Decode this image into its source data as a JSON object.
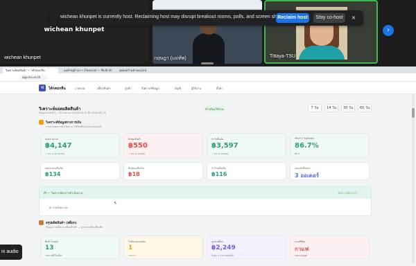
{
  "meeting": {
    "tile1_big_name": "wichean khunpet",
    "tile1_label": "wichean khunpet",
    "tile2_label": "กฤษฎา (แม่ทัพ)",
    "tile3_label": "Tittaya-TSU",
    "next_icon": "chevron-right-icon",
    "audio_chip": "in audio"
  },
  "banner": {
    "text": "wichean khunpet is currently host. Reclaiming host may disrupt breakout rooms, polls, and screen share",
    "reclaim": "Reclaim host",
    "cohost": "Stay co-host",
    "close": "×"
  },
  "browser": {
    "tabs": [
      "วิเคราะห์ผลสินค้า — ได้กลมกลืน",
      "แม่ค้าอยู่บ้านฯ • Financial — Multi-ch",
      "สุดยอดร้านค้าออนไลน์"
    ],
    "url": "app.tsu.ac.th"
  },
  "app": {
    "logo": "ฟ",
    "name": "ได้กลมกลืน",
    "nav": [
      "ภาพรวม",
      "สต็อกสินค้า",
      "ลูกค้า",
      "วิเคราะห์ข้อมูล",
      "บัญชี",
      "ผู้ใช้งาน",
      "ตั้งค่า"
    ]
  },
  "page": {
    "title": "วิเคราะห์ยอดผลิตสินค้า",
    "subtitle": "ข้อมูลช่วงวันที่ 1 – 30 เมษายน (2026-05-14 ถึง 2026-06-13)",
    "ai_pill": "AI พร้อมใช้งาน",
    "periods": [
      "7 วัน",
      "14 วัน",
      "30 วัน",
      "60 วัน"
    ]
  },
  "section1": {
    "title": "วิเคราะห์ข้อมูลทางการเงิน",
    "subtitle": "ภาพรวมผลการดำเนินงาน เปรียบเทียบกับช่วงก่อนหน้า"
  },
  "kpis": [
    {
      "label": "ยอดขายรวม",
      "value": "฿4,147",
      "note": "↑ 0% vs 30 วันก่อน",
      "color": "#2e9d77"
    },
    {
      "label": "ต้นทุนสินค้า",
      "value": "฿550",
      "note": "↑ 0% vs ช่วงก่อน",
      "color": "#e05050"
    },
    {
      "label": "กำไรขั้นต้น",
      "value": "฿3,597",
      "note": "↑ 0% vs ช่วงก่อน",
      "color": "#2e9d77"
    },
    {
      "label": "PROFIT MARGIN",
      "value": "86.7%",
      "note": "ดีมาก",
      "color": "#2e9d77"
    },
    {
      "label": "ยอดขายเฉลี่ย/บิล",
      "value": "฿134",
      "note": "",
      "color": "#2e9d77"
    },
    {
      "label": "ต้นทุนเฉลี่ย/บิล",
      "value": "฿18",
      "note": "",
      "color": "#e05050"
    },
    {
      "label": "กำไรเฉลี่ย/บิล",
      "value": "฿116",
      "note": "",
      "color": "#2e9d77"
    },
    {
      "label": "ออเดอร์ทั้งหมด",
      "value": "3 ออเดอร์",
      "note": "",
      "color": "#5b6ad0"
    }
  ],
  "ai_panel": {
    "title": "AI — วิเคราะห์ผลการดำเนินงาน",
    "button": "วิเคราะห์ด้วย AI",
    "body": "AI กำลังวิเคราะห์..."
  },
  "section2": {
    "title": "สรุปผลิตสินค้า (สต็อก)",
    "subtitle": "ข้อมูลการผลิตและสต็อกสินค้า — ดูรายละเอียดเพิ่มเติม"
  },
  "stock": [
    {
      "label": "สินค้าในคลัง",
      "value": "13",
      "note": "รายการที่มีในสต็อก",
      "color": "#2e9d77",
      "bg": "#eefaf3"
    },
    {
      "label": "ใกล้หมด/รอผลิต",
      "value": "1",
      "note": "รายการ",
      "color": "#e0a020",
      "bg": "#fff8e6"
    },
    {
      "label": "มูลค่าสต็อก",
      "value": "฿2,249",
      "note": "ต้นทุน × จำนวนคงเหลือ",
      "color": "#7a5cd0",
      "bg": "#f4f0fd"
    },
    {
      "label": "ขายดีที่สุด",
      "value": "กาแฟ",
      "note": "ยอดขายสูงสุด",
      "color": "#e05050",
      "bg": "#fdf0f0"
    }
  ]
}
